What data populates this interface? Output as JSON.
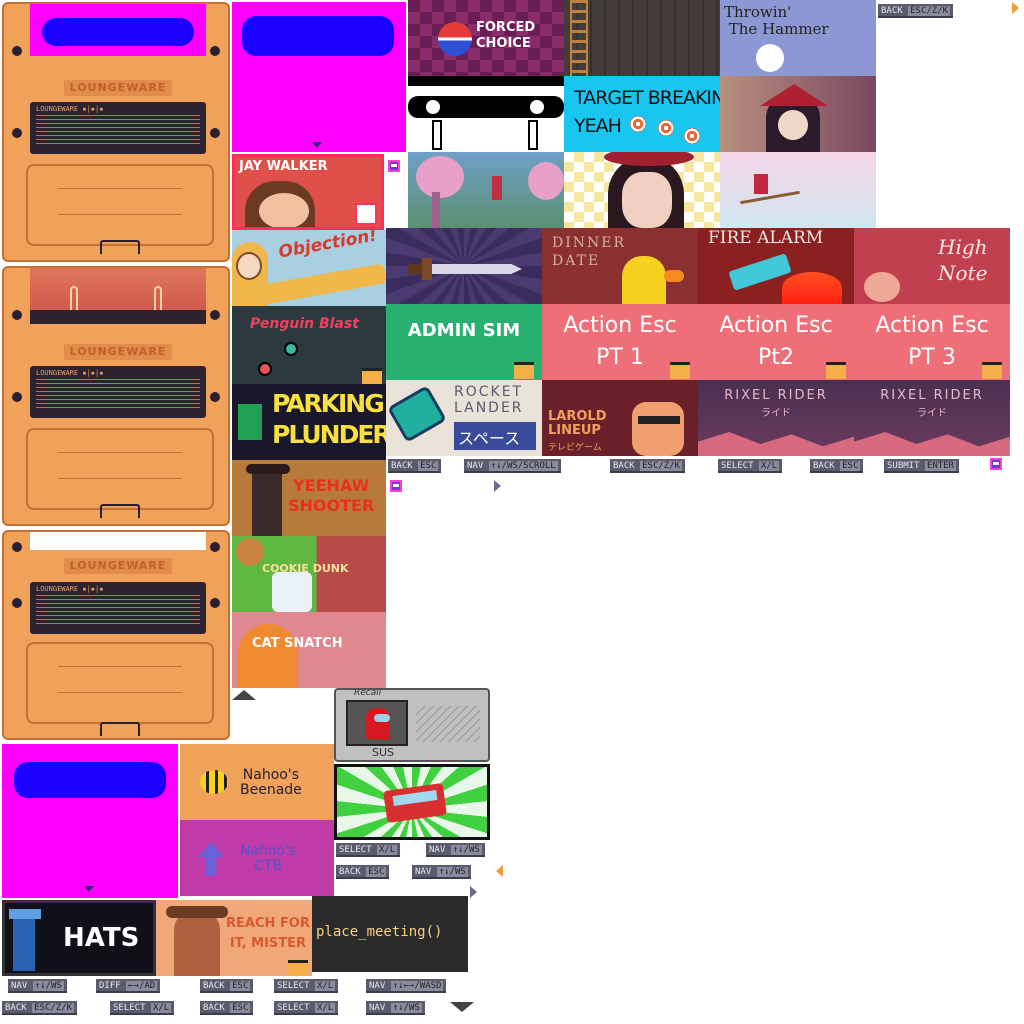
{
  "cart": {
    "brand": "LOUNGEWARE",
    "label_text": "LOUNGEWARE  ▪|▪|▪"
  },
  "chips_top": [
    {
      "a": "BACK",
      "b": "ESC/Z/K"
    }
  ],
  "chips_row": [
    {
      "a": "BACK",
      "b": "ESC"
    },
    {
      "a": "NAV",
      "b": "↑↓/WS/SCROLL"
    },
    {
      "a": "BACK",
      "b": "ESC/Z/K"
    },
    {
      "a": "SELECT",
      "b": "X/L"
    },
    {
      "a": "BACK",
      "b": "ESC"
    },
    {
      "a": "SUBMIT",
      "b": "ENTER"
    }
  ],
  "chips_mid": [
    {
      "a": "SELECT",
      "b": "X/L"
    },
    {
      "a": "NAV",
      "b": "↑↓/WS"
    },
    {
      "a": "BACK",
      "b": "ESC"
    },
    {
      "a": "NAV",
      "b": "↑↓/WS"
    }
  ],
  "chips_bottom1": [
    {
      "a": "NAV",
      "b": "↑↓/WS"
    },
    {
      "a": "DIFF",
      "b": "←→/AD"
    },
    {
      "a": "BACK",
      "b": "ESC"
    },
    {
      "a": "SELECT",
      "b": "X/L"
    },
    {
      "a": "NAV",
      "b": "↑↓←→/WASD"
    }
  ],
  "chips_bottom2": [
    {
      "a": "BACK",
      "b": "ESC/Z/K"
    },
    {
      "a": "SELECT",
      "b": "X/L"
    },
    {
      "a": "BACK",
      "b": "ESC"
    },
    {
      "a": "SELECT",
      "b": "X/L"
    },
    {
      "a": "NAV",
      "b": "↑↓/WS"
    }
  ],
  "games": {
    "forced": "FORCED\nCHOICE",
    "hammer": "Throwin'\n The Hammer",
    "target": "TARGET BREAKING\nYEAH",
    "jay": "JAY WALKER",
    "objection": "Objection!",
    "dinner": "DINNER\nDATE",
    "fire": "FIRE ALARM",
    "high": "High\nNote",
    "penguin": "Penguin Blast",
    "admin": "ADMIN SIM",
    "act1": "Action Esc\nPT 1",
    "act2": "Action Esc\nPt2",
    "act3": "Action Esc\nPT 3",
    "parking": "PARKING\nPLUNDER",
    "rocket": "ROCKET\nLANDER",
    "rocket_jp": "スペース",
    "larold": "LAROLD\nLINEUP",
    "larold_jp": "テレビゲーム",
    "rixel1": "RIXEL RIDER",
    "rixel2": "RIXEL RIDER",
    "rixel_jp": "ライド",
    "yeehaw": "YEEHAW\nSHOOTER",
    "cookie": "COOKIE DUNK",
    "catsnatch": "CAT SNATCH",
    "sus": "SUS",
    "recall": "Recall",
    "beenade": "Nahoo's\nBeenade",
    "ctb": "Nahoo's\nCTB",
    "hats": "HATS",
    "reach": "REACH FOR\nIT, MISTER",
    "place": "place_meeting()"
  },
  "colors": {
    "orange": "#f0a25a",
    "magenta": "#ff00ff",
    "blue": "#1a00ff",
    "salmon": "#ef6f78",
    "dark": "#2c2230"
  }
}
